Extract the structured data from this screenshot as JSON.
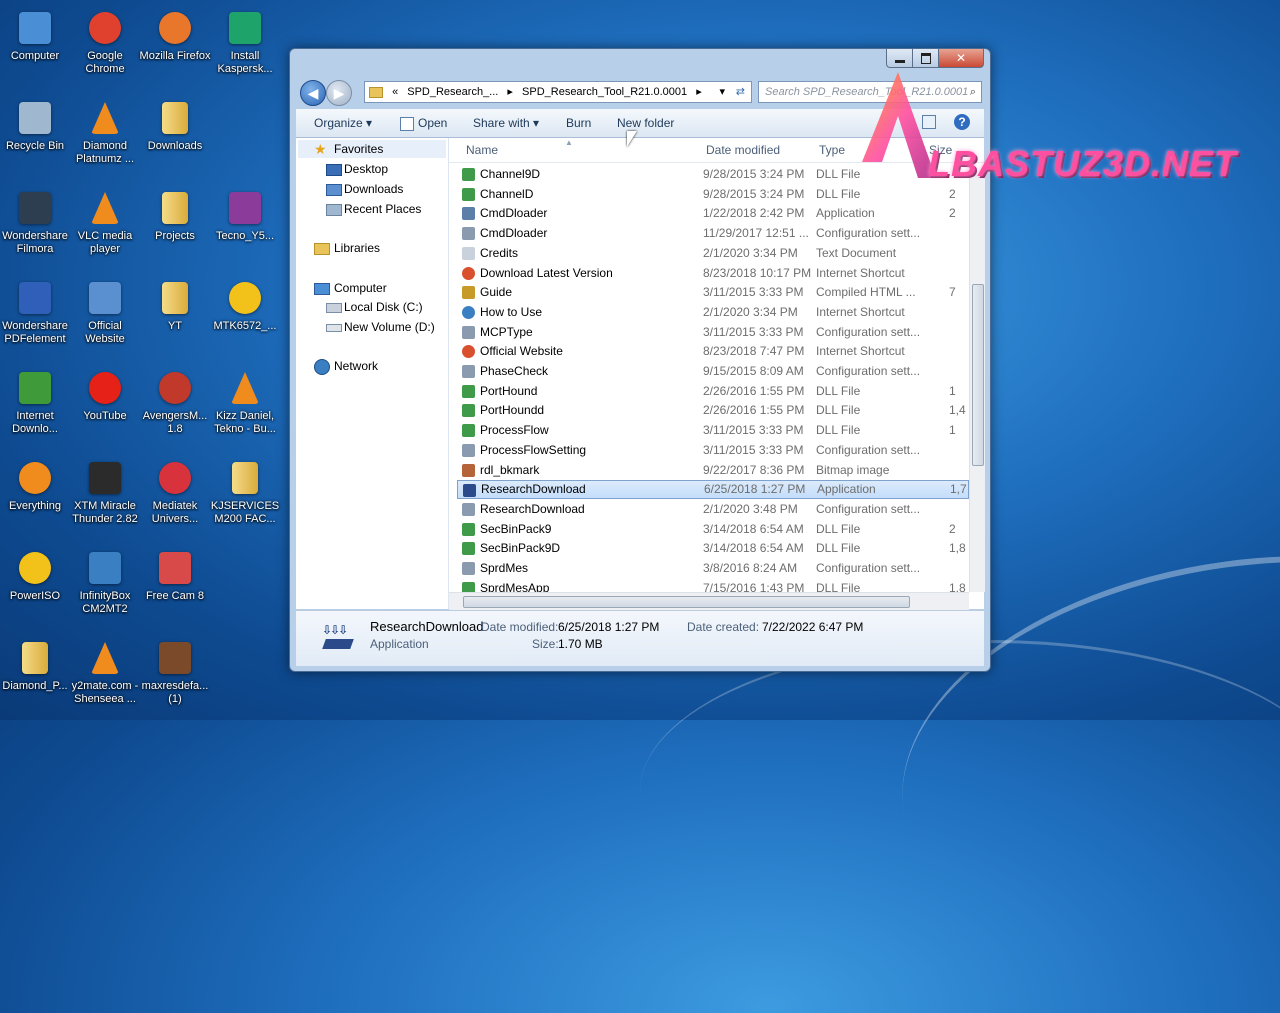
{
  "desktop": {
    "icons": [
      {
        "label": "Computer",
        "icon": "computer-icon",
        "color": "#4a8fd6"
      },
      {
        "label": "Google Chrome",
        "icon": "chrome-icon",
        "color": "#e0412e"
      },
      {
        "label": "Mozilla Firefox",
        "icon": "firefox-icon",
        "color": "#e8762b"
      },
      {
        "label": "Install Kaspersk...",
        "icon": "kaspersky-icon",
        "color": "#1ea36b"
      },
      {
        "label": "Recycle Bin",
        "icon": "recycle-bin-icon",
        "color": "#9fb7cf"
      },
      {
        "label": "Diamond Platnumz ...",
        "icon": "vlc-icon",
        "color": "#f08b1e"
      },
      {
        "label": "Downloads",
        "icon": "folder-icon",
        "color": "#e8c45a"
      },
      {
        "label": "Wondershare Filmora",
        "icon": "filmora-icon",
        "color": "#2c3e50"
      },
      {
        "label": "VLC media player",
        "icon": "vlc-icon",
        "color": "#f08b1e"
      },
      {
        "label": "Projects",
        "icon": "folder-icon",
        "color": "#e8c45a"
      },
      {
        "label": "Tecno_Y5...",
        "icon": "winrar-icon",
        "color": "#8b3b9a"
      },
      {
        "label": "Wondershare PDFelement",
        "icon": "pdfelement-icon",
        "color": "#2f5fb8"
      },
      {
        "label": "Official Website",
        "icon": "website-icon",
        "color": "#5a8fd0"
      },
      {
        "label": "YT",
        "icon": "folder-icon",
        "color": "#e8c45a"
      },
      {
        "label": "MTK6572_...",
        "icon": "disc-icon",
        "color": "#f2c21b"
      },
      {
        "label": "Internet Downlo...",
        "icon": "idm-icon",
        "color": "#3f9a3a"
      },
      {
        "label": "YouTube",
        "icon": "youtube-icon",
        "color": "#e62117"
      },
      {
        "label": "AvengersM... 1.8",
        "icon": "avengers-icon",
        "color": "#c0392b"
      },
      {
        "label": "Kizz Daniel, Tekno - Bu...",
        "icon": "vlc-icon",
        "color": "#f08b1e"
      },
      {
        "label": "Everything",
        "icon": "everything-icon",
        "color": "#f08b1e"
      },
      {
        "label": "XTM Miracle Thunder 2.82",
        "icon": "miracle-icon",
        "color": "#2b2b2b"
      },
      {
        "label": "Mediatek Univers...",
        "icon": "mediatek-icon",
        "color": "#d8333c"
      },
      {
        "label": "KJSERVICES M200 FAC...",
        "icon": "folder-icon",
        "color": "#e8c45a"
      },
      {
        "label": "PowerISO",
        "icon": "poweriso-icon",
        "color": "#f2c21b"
      },
      {
        "label": "InfinityBox CM2MT2",
        "icon": "infinitybox-icon",
        "color": "#3a7fc2"
      },
      {
        "label": "Free Cam 8",
        "icon": "freecam-icon",
        "color": "#d84a4a"
      },
      {
        "label": "Diamond_P...",
        "icon": "folder-icon",
        "color": "#e8c45a"
      },
      {
        "label": "y2mate.com - Shenseea ...",
        "icon": "vlc-icon",
        "color": "#f08b1e"
      },
      {
        "label": "maxresdefa... (1)",
        "icon": "image-thumb-icon",
        "color": "#7a4a2a"
      }
    ]
  },
  "window": {
    "address": {
      "segments": [
        "«",
        "SPD_Research_...",
        "▸",
        "SPD_Research_Tool_R21.0.0001",
        "▸"
      ]
    },
    "search_placeholder": "Search SPD_Research_Tool_R21.0.0001",
    "toolbar": {
      "organize": "Organize ▾",
      "open": "Open",
      "share_with": "Share with ▾",
      "burn": "Burn",
      "new_folder": "New folder"
    },
    "nav": {
      "favorites": "Favorites",
      "desktop": "Desktop",
      "downloads": "Downloads",
      "recent": "Recent Places",
      "libraries": "Libraries",
      "computer": "Computer",
      "local_disk": "Local Disk (C:)",
      "new_volume": "New Volume (D:)",
      "network": "Network"
    },
    "columns": {
      "name": "Name",
      "date": "Date modified",
      "type": "Type",
      "size": "Size"
    },
    "files": [
      {
        "name": "Channel9D",
        "date": "9/28/2015 3:24 PM",
        "type": "DLL File",
        "size": "",
        "icon": "dll-icon",
        "color": "#3f9a4a"
      },
      {
        "name": "ChannelD",
        "date": "9/28/2015 3:24 PM",
        "type": "DLL File",
        "size": "2",
        "icon": "dll-icon",
        "color": "#3f9a4a"
      },
      {
        "name": "CmdDloader",
        "date": "1/22/2018 2:42 PM",
        "type": "Application",
        "size": "2",
        "icon": "application-icon",
        "color": "#5b7fa8"
      },
      {
        "name": "CmdDloader",
        "date": "11/29/2017 12:51 ...",
        "type": "Configuration sett...",
        "size": "",
        "icon": "config-icon",
        "color": "#8a9bb0"
      },
      {
        "name": "Credits",
        "date": "2/1/2020 3:34 PM",
        "type": "Text Document",
        "size": "",
        "icon": "text-doc-icon",
        "color": "#c9d2dc"
      },
      {
        "name": "Download Latest Version",
        "date": "8/23/2018 10:17 PM",
        "type": "Internet Shortcut",
        "size": "",
        "icon": "internet-shortcut-icon",
        "color": "#d9502f"
      },
      {
        "name": "Guide",
        "date": "3/11/2015 3:33 PM",
        "type": "Compiled HTML ...",
        "size": "7",
        "icon": "chm-icon",
        "color": "#c89a2a"
      },
      {
        "name": "How to Use",
        "date": "2/1/2020 3:34 PM",
        "type": "Internet Shortcut",
        "size": "",
        "icon": "internet-shortcut-icon",
        "color": "#3a7fc2"
      },
      {
        "name": "MCPType",
        "date": "3/11/2015 3:33 PM",
        "type": "Configuration sett...",
        "size": "",
        "icon": "config-icon",
        "color": "#8a9bb0"
      },
      {
        "name": "Official Website",
        "date": "8/23/2018 7:47 PM",
        "type": "Internet Shortcut",
        "size": "",
        "icon": "internet-shortcut-icon",
        "color": "#d9502f"
      },
      {
        "name": "PhaseCheck",
        "date": "9/15/2015 8:09 AM",
        "type": "Configuration sett...",
        "size": "",
        "icon": "config-icon",
        "color": "#8a9bb0"
      },
      {
        "name": "PortHound",
        "date": "2/26/2016 1:55 PM",
        "type": "DLL File",
        "size": "1",
        "icon": "dll-icon",
        "color": "#3f9a4a"
      },
      {
        "name": "PortHoundd",
        "date": "2/26/2016 1:55 PM",
        "type": "DLL File",
        "size": "1,4",
        "icon": "dll-icon",
        "color": "#3f9a4a"
      },
      {
        "name": "ProcessFlow",
        "date": "3/11/2015 3:33 PM",
        "type": "DLL File",
        "size": "1",
        "icon": "dll-icon",
        "color": "#3f9a4a"
      },
      {
        "name": "ProcessFlowSetting",
        "date": "3/11/2015 3:33 PM",
        "type": "Configuration sett...",
        "size": "",
        "icon": "config-icon",
        "color": "#8a9bb0"
      },
      {
        "name": "rdl_bkmark",
        "date": "9/22/2017 8:36 PM",
        "type": "Bitmap image",
        "size": "",
        "icon": "bitmap-icon",
        "color": "#b5643a"
      },
      {
        "name": "ResearchDownload",
        "date": "6/25/2018 1:27 PM",
        "type": "Application",
        "size": "1,7",
        "icon": "research-download-icon",
        "color": "#2a4a8a",
        "selected": true
      },
      {
        "name": "ResearchDownload",
        "date": "2/1/2020 3:48 PM",
        "type": "Configuration sett...",
        "size": "",
        "icon": "config-icon",
        "color": "#8a9bb0"
      },
      {
        "name": "SecBinPack9",
        "date": "3/14/2018 6:54 AM",
        "type": "DLL File",
        "size": "2",
        "icon": "dll-icon",
        "color": "#3f9a4a"
      },
      {
        "name": "SecBinPack9D",
        "date": "3/14/2018 6:54 AM",
        "type": "DLL File",
        "size": "1,8",
        "icon": "dll-icon",
        "color": "#3f9a4a"
      },
      {
        "name": "SprdMes",
        "date": "3/8/2016 8:24 AM",
        "type": "Configuration sett...",
        "size": "",
        "icon": "config-icon",
        "color": "#8a9bb0"
      },
      {
        "name": "SprdMesApp",
        "date": "7/15/2016 1:43 PM",
        "type": "DLL File",
        "size": "1,8",
        "icon": "dll-icon",
        "color": "#3f9a4a"
      }
    ],
    "details": {
      "name": "ResearchDownload",
      "kind": "Application",
      "date_modified_label": "Date modified:",
      "date_modified": "6/25/2018 1:27 PM",
      "size_label": "Size:",
      "size": "1.70 MB",
      "date_created_label": "Date created:",
      "date_created": "7/22/2022 6:47 PM"
    }
  },
  "watermark": {
    "text": "LBASTUZ3D.NET",
    "color": "#ff4fa0"
  }
}
